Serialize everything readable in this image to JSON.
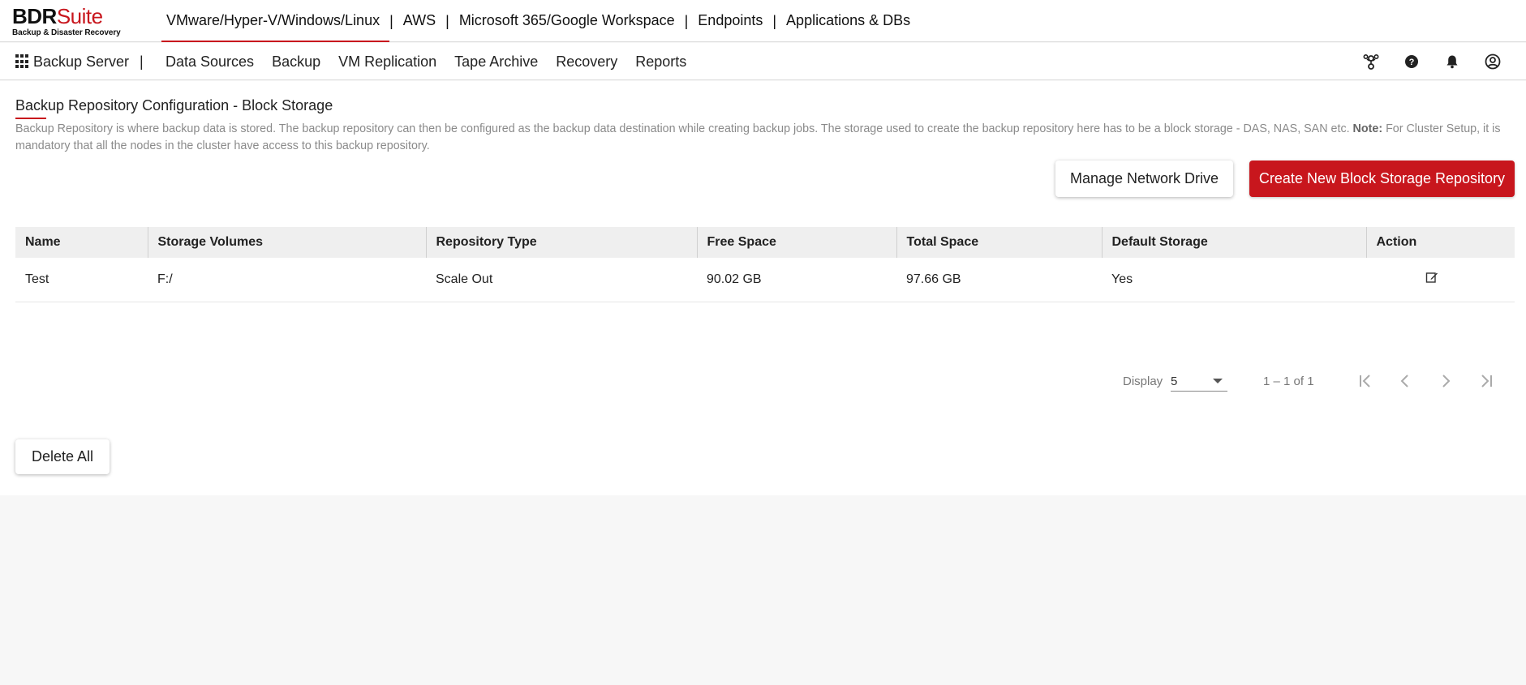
{
  "logo": {
    "part1": "BDR",
    "part2": "Suite",
    "tagline": "Backup & Disaster Recovery"
  },
  "products": [
    {
      "label": "VMware/Hyper-V/Windows/Linux",
      "active": true
    },
    {
      "label": "AWS"
    },
    {
      "label": "Microsoft 365/Google Workspace"
    },
    {
      "label": "Endpoints"
    },
    {
      "label": "Applications & DBs"
    }
  ],
  "separator": "|",
  "nav": {
    "server_label": "Backup Server",
    "items": [
      "Data Sources",
      "Backup",
      "VM Replication",
      "Tape Archive",
      "Recovery",
      "Reports"
    ],
    "icons": [
      "users-network-icon",
      "help-icon",
      "bell-icon",
      "user-profile-icon"
    ]
  },
  "page": {
    "title": "Backup Repository Configuration - Block Storage",
    "description": "Backup Repository is where backup data is stored. The backup repository can then be configured as the backup data destination while creating backup jobs. The storage used to create the backup repository here has to be a block storage - DAS, NAS, SAN etc.",
    "note_label": "Note:",
    "note_text": "For Cluster Setup, it is mandatory that all the nodes in the cluster have access to this backup repository.",
    "manage_button": "Manage Network Drive",
    "create_button": "Create New Block Storage Repository",
    "delete_button": "Delete All"
  },
  "table": {
    "columns": [
      "Name",
      "Storage Volumes",
      "Repository Type",
      "Free Space",
      "Total Space",
      "Default Storage",
      "Action"
    ],
    "rows": [
      {
        "name": "Test",
        "volumes": "F:/",
        "type": "Scale Out",
        "free": "90.02 GB",
        "total": "97.66 GB",
        "default": "Yes"
      }
    ]
  },
  "pagination": {
    "display_label": "Display",
    "page_size": "5",
    "range": "1 – 1 of 1"
  },
  "colors": {
    "accent": "#c8161d",
    "header_bg": "#efefef",
    "page_bg": "#f7f7f7"
  }
}
